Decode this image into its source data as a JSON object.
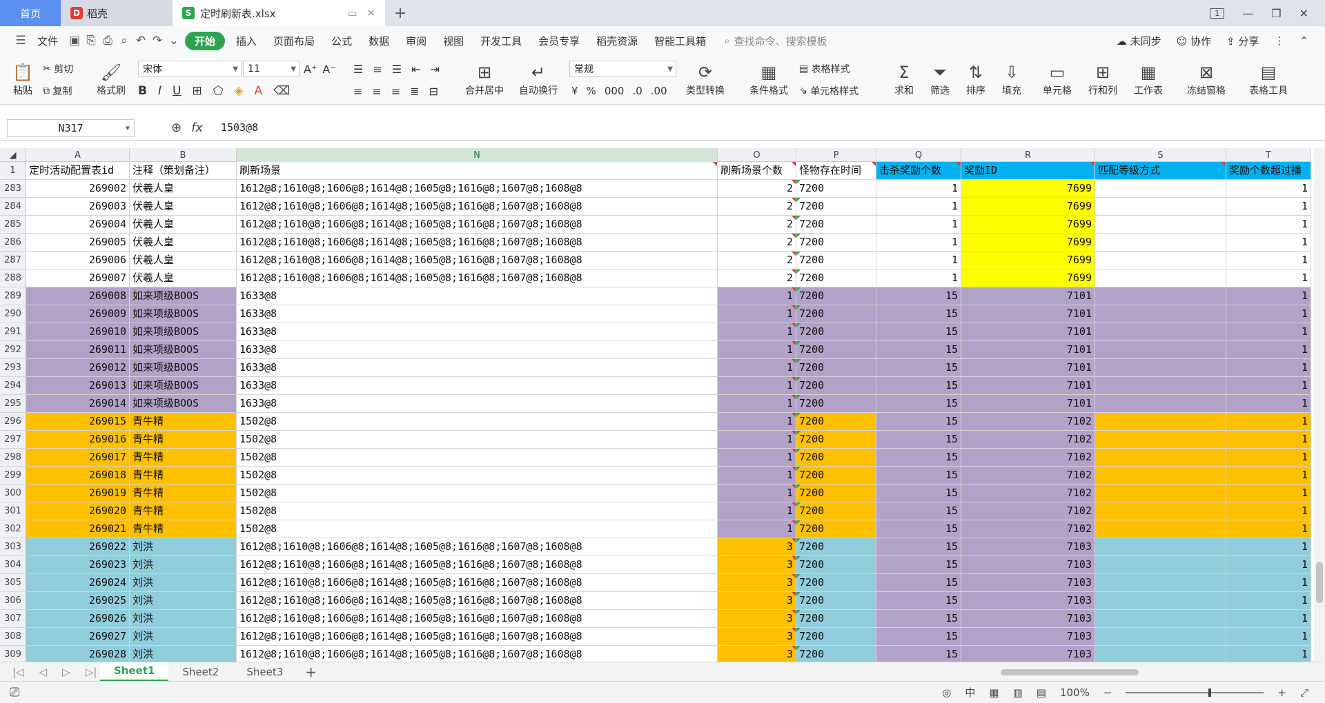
{
  "tabs": {
    "home": "首页",
    "daoke": "稻壳",
    "file": "定时刷新表.xlsx",
    "add": "+"
  },
  "menu": {
    "file": "文件",
    "items": [
      "开始",
      "插入",
      "页面布局",
      "公式",
      "数据",
      "审阅",
      "视图",
      "开发工具",
      "会员专享",
      "稻壳资源",
      "智能工具箱"
    ],
    "search_placeholder": "查找命令、搜索模板",
    "unsync": "未同步",
    "collab": "协作",
    "share": "分享"
  },
  "ribbon": {
    "paste": "粘贴",
    "cut": "剪切",
    "copy": "复制",
    "format_painter": "格式刷",
    "font": "宋体",
    "size": "11",
    "merge": "合并居中",
    "wrap": "自动换行",
    "number_format": "常规",
    "type_convert": "类型转换",
    "cond_format": "条件格式",
    "table_style": "表格样式",
    "cell_style": "单元格样式",
    "sum": "求和",
    "filter": "筛选",
    "sort": "排序",
    "fill": "填充",
    "cell": "单元格",
    "rowcol": "行和列",
    "sheet": "工作表",
    "freeze": "冻结窗格",
    "table_tools": "表格工具"
  },
  "formula_bar": {
    "cell_ref": "N317",
    "fx": "fx",
    "value": "1503@8"
  },
  "columns": [
    {
      "letter": "A",
      "header": "定时活动配置表id"
    },
    {
      "letter": "B",
      "header": "注释（策划备注）"
    },
    {
      "letter": "N",
      "header": "刷新场景"
    },
    {
      "letter": "O",
      "header": "刷新场景个数"
    },
    {
      "letter": "P",
      "header": "怪物存在时间"
    },
    {
      "letter": "Q",
      "header": "击杀奖励个数"
    },
    {
      "letter": "R",
      "header": "奖励ID"
    },
    {
      "letter": "S",
      "header": "匹配等级方式"
    },
    {
      "letter": "T",
      "header": "奖励个数超过播"
    }
  ],
  "colors": {
    "purple": "#b3a2c7",
    "orange": "#ffc000",
    "teal": "#92cddc",
    "yellow": "#ffff00",
    "cyan_header": "#00b0f0",
    "accent_green": "#2ea44f"
  },
  "rows": [
    {
      "n": "283",
      "a": "269002",
      "b": "伏羲人皇",
      "scene": "1612@8;1610@8;1606@8;1614@8;1605@8;1616@8;1607@8;1608@8",
      "o": "2",
      "p": "7200",
      "q": "1",
      "r": "7699",
      "t": "1"
    },
    {
      "n": "284",
      "a": "269003",
      "b": "伏羲人皇",
      "scene": "1612@8;1610@8;1606@8;1614@8;1605@8;1616@8;1607@8;1608@8",
      "o": "2",
      "p": "7200",
      "q": "1",
      "r": "7699",
      "t": "1"
    },
    {
      "n": "285",
      "a": "269004",
      "b": "伏羲人皇",
      "scene": "1612@8;1610@8;1606@8;1614@8;1605@8;1616@8;1607@8;1608@8",
      "o": "2",
      "p": "7200",
      "q": "1",
      "r": "7699",
      "t": "1"
    },
    {
      "n": "286",
      "a": "269005",
      "b": "伏羲人皇",
      "scene": "1612@8;1610@8;1606@8;1614@8;1605@8;1616@8;1607@8;1608@8",
      "o": "2",
      "p": "7200",
      "q": "1",
      "r": "7699",
      "t": "1"
    },
    {
      "n": "287",
      "a": "269006",
      "b": "伏羲人皇",
      "scene": "1612@8;1610@8;1606@8;1614@8;1605@8;1616@8;1607@8;1608@8",
      "o": "2",
      "p": "7200",
      "q": "1",
      "r": "7699",
      "t": "1"
    },
    {
      "n": "288",
      "a": "269007",
      "b": "伏羲人皇",
      "scene": "1612@8;1610@8;1606@8;1614@8;1605@8;1616@8;1607@8;1608@8",
      "o": "2",
      "p": "7200",
      "q": "1",
      "r": "7699",
      "t": "1"
    },
    {
      "n": "289",
      "a": "269008",
      "b": "如来项级BOOS",
      "scene": "1633@8",
      "o": "1",
      "p": "7200",
      "q": "15",
      "r": "7101",
      "t": "1"
    },
    {
      "n": "290",
      "a": "269009",
      "b": "如来项级BOOS",
      "scene": "1633@8",
      "o": "1",
      "p": "7200",
      "q": "15",
      "r": "7101",
      "t": "1"
    },
    {
      "n": "291",
      "a": "269010",
      "b": "如来项级BOOS",
      "scene": "1633@8",
      "o": "1",
      "p": "7200",
      "q": "15",
      "r": "7101",
      "t": "1"
    },
    {
      "n": "292",
      "a": "269011",
      "b": "如来项级BOOS",
      "scene": "1633@8",
      "o": "1",
      "p": "7200",
      "q": "15",
      "r": "7101",
      "t": "1"
    },
    {
      "n": "293",
      "a": "269012",
      "b": "如来项级BOOS",
      "scene": "1633@8",
      "o": "1",
      "p": "7200",
      "q": "15",
      "r": "7101",
      "t": "1"
    },
    {
      "n": "294",
      "a": "269013",
      "b": "如来项级BOOS",
      "scene": "1633@8",
      "o": "1",
      "p": "7200",
      "q": "15",
      "r": "7101",
      "t": "1"
    },
    {
      "n": "295",
      "a": "269014",
      "b": "如来项级BOOS",
      "scene": "1633@8",
      "o": "1",
      "p": "7200",
      "q": "15",
      "r": "7101",
      "t": "1"
    },
    {
      "n": "296",
      "a": "269015",
      "b": "青牛精",
      "scene": "1502@8",
      "o": "1",
      "p": "7200",
      "q": "15",
      "r": "7102",
      "t": "1"
    },
    {
      "n": "297",
      "a": "269016",
      "b": "青牛精",
      "scene": "1502@8",
      "o": "1",
      "p": "7200",
      "q": "15",
      "r": "7102",
      "t": "1"
    },
    {
      "n": "298",
      "a": "269017",
      "b": "青牛精",
      "scene": "1502@8",
      "o": "1",
      "p": "7200",
      "q": "15",
      "r": "7102",
      "t": "1"
    },
    {
      "n": "299",
      "a": "269018",
      "b": "青牛精",
      "scene": "1502@8",
      "o": "1",
      "p": "7200",
      "q": "15",
      "r": "7102",
      "t": "1"
    },
    {
      "n": "300",
      "a": "269019",
      "b": "青牛精",
      "scene": "1502@8",
      "o": "1",
      "p": "7200",
      "q": "15",
      "r": "7102",
      "t": "1"
    },
    {
      "n": "301",
      "a": "269020",
      "b": "青牛精",
      "scene": "1502@8",
      "o": "1",
      "p": "7200",
      "q": "15",
      "r": "7102",
      "t": "1"
    },
    {
      "n": "302",
      "a": "269021",
      "b": "青牛精",
      "scene": "1502@8",
      "o": "1",
      "p": "7200",
      "q": "15",
      "r": "7102",
      "t": "1"
    },
    {
      "n": "303",
      "a": "269022",
      "b": "刘洪",
      "scene": "1612@8;1610@8;1606@8;1614@8;1605@8;1616@8;1607@8;1608@8",
      "o": "3",
      "p": "7200",
      "q": "15",
      "r": "7103",
      "t": "1"
    },
    {
      "n": "304",
      "a": "269023",
      "b": "刘洪",
      "scene": "1612@8;1610@8;1606@8;1614@8;1605@8;1616@8;1607@8;1608@8",
      "o": "3",
      "p": "7200",
      "q": "15",
      "r": "7103",
      "t": "1"
    },
    {
      "n": "305",
      "a": "269024",
      "b": "刘洪",
      "scene": "1612@8;1610@8;1606@8;1614@8;1605@8;1616@8;1607@8;1608@8",
      "o": "3",
      "p": "7200",
      "q": "15",
      "r": "7103",
      "t": "1"
    },
    {
      "n": "306",
      "a": "269025",
      "b": "刘洪",
      "scene": "1612@8;1610@8;1606@8;1614@8;1605@8;1616@8;1607@8;1608@8",
      "o": "3",
      "p": "7200",
      "q": "15",
      "r": "7103",
      "t": "1"
    },
    {
      "n": "307",
      "a": "269026",
      "b": "刘洪",
      "scene": "1612@8;1610@8;1606@8;1614@8;1605@8;1616@8;1607@8;1608@8",
      "o": "3",
      "p": "7200",
      "q": "15",
      "r": "7103",
      "t": "1"
    },
    {
      "n": "308",
      "a": "269027",
      "b": "刘洪",
      "scene": "1612@8;1610@8;1606@8;1614@8;1605@8;1616@8;1607@8;1608@8",
      "o": "3",
      "p": "7200",
      "q": "15",
      "r": "7103",
      "t": "1"
    },
    {
      "n": "309",
      "a": "269028",
      "b": "刘洪",
      "scene": "1612@8;1610@8;1606@8;1614@8;1605@8;1616@8;1607@8;1608@8",
      "o": "3",
      "p": "7200",
      "q": "15",
      "r": "7103",
      "t": "1"
    }
  ],
  "row_groups": {
    "283": "yellow",
    "284": "yellow",
    "285": "yellow",
    "286": "yellow",
    "287": "yellow",
    "288": "yellow",
    "289": "purple",
    "290": "purple",
    "291": "purple",
    "292": "purple",
    "293": "purple",
    "294": "purple",
    "295": "purple",
    "296": "orange",
    "297": "orange",
    "298": "orange",
    "299": "orange",
    "300": "orange",
    "301": "orange",
    "302": "orange",
    "303": "teal",
    "304": "teal",
    "305": "teal",
    "306": "teal",
    "307": "teal",
    "308": "teal",
    "309": "teal"
  },
  "sheets": [
    "Sheet1",
    "Sheet2",
    "Sheet3"
  ],
  "status": {
    "zoom": "100%"
  }
}
